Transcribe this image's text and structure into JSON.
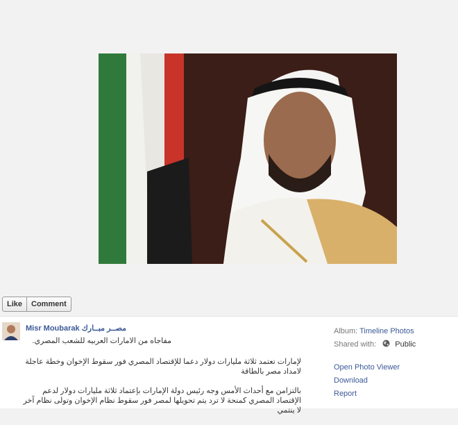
{
  "ufi": {
    "like_label": "Like",
    "comment_label": "Comment"
  },
  "post": {
    "author_name": "Misr Moubarak مصــر مبــارك",
    "caption_line1": "مفاجاه من الامارات العربيه للشعب المصري.",
    "headline": "لإمارات تعتمد ثلاثة مليارات دولار دعما للإقتصاد المصري فور سقوط الإخوان وخطة عاجلة لامداد مصر بالطاقة",
    "body": "بالتزامن مع أحداث الأمس وجه رئيس دولة الإمارات بإعتماد ثلاثة مليارات دولار لدعم الإقتصاد المصري كمنحة لا ترد يتم تحويلها لمصر فور سقوط نظام الإخوان وتولى نظام آخر لا ينتمي"
  },
  "sidebar": {
    "album_label": "Album:",
    "album_value": "Timeline Photos",
    "shared_label": "Shared with:",
    "shared_value": "Public",
    "actions": [
      "Open Photo Viewer",
      "Download",
      "Report"
    ]
  },
  "icons": {
    "globe": "globe-icon"
  },
  "colors": {
    "link": "#3b5998",
    "photo_background": "#3a1d17"
  }
}
